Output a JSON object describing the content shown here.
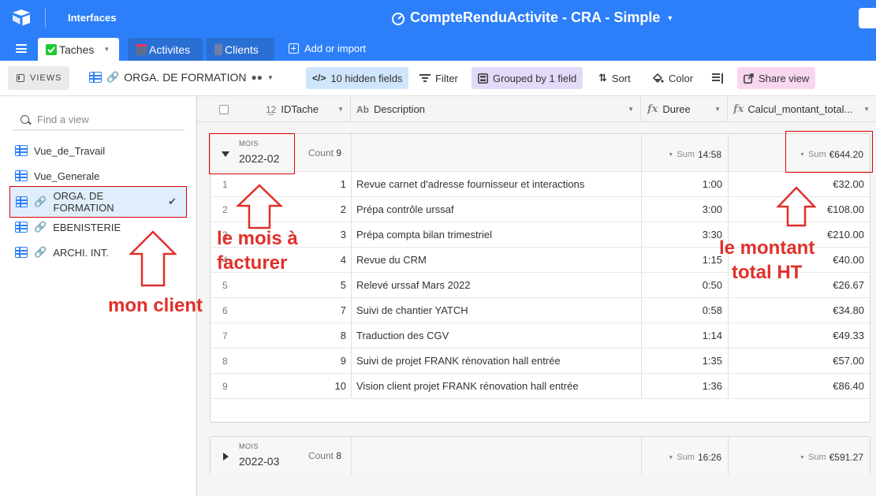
{
  "topbar": {
    "interfaces": "Interfaces",
    "base_title": "CompteRenduActivite - CRA - Simple",
    "accent": "#2d7ff9"
  },
  "tabs": [
    {
      "label": "Taches",
      "icon": "check-square-icon",
      "color": "#20c933"
    },
    {
      "label": "Activites",
      "icon": "table-icon",
      "color": "#f82b60"
    },
    {
      "label": "Clients",
      "icon": "people-icon",
      "color": "#8b46ff"
    }
  ],
  "add_import": "Add or import",
  "toolbar": {
    "views": "VIEWS",
    "view_name": "ORGA. DE FORMATION",
    "hidden_fields": "10 hidden fields",
    "filter": "Filter",
    "grouped": "Grouped by 1 field",
    "sort": "Sort",
    "color": "Color",
    "share": "Share view"
  },
  "sidebar": {
    "find_placeholder": "Find a view",
    "items": [
      {
        "label": "Vue_de_Travail"
      },
      {
        "label": "Vue_Generale"
      },
      {
        "label": "ORGA. DE FORMATION"
      },
      {
        "label": "EBENISTERIE"
      },
      {
        "label": "ARCHI. INT."
      }
    ]
  },
  "columns": {
    "id": "IDTache",
    "desc": "Description",
    "dur": "Duree",
    "amt": "Calcul_montant_total..."
  },
  "groups": [
    {
      "label": "MOIS",
      "value": "2022-02",
      "count_label": "Count",
      "count": "9",
      "sum_label": "Sum",
      "sum_duree": "14:58",
      "sum_montant": "€644.20",
      "rows": [
        {
          "n": "1",
          "id": "1",
          "desc": "Revue carnet d'adresse fournisseur et interactions",
          "dur": "1:00",
          "amt": "€32.00"
        },
        {
          "n": "2",
          "id": "2",
          "desc": "Prépa contrôle urssaf",
          "dur": "3:00",
          "amt": "€108.00"
        },
        {
          "n": "3",
          "id": "3",
          "desc": "Prépa compta bilan trimestriel",
          "dur": "3:30",
          "amt": "€210.00"
        },
        {
          "n": "4",
          "id": "4",
          "desc": "Revue du CRM",
          "dur": "1:15",
          "amt": "€40.00"
        },
        {
          "n": "5",
          "id": "5",
          "desc": "Relevé urssaf Mars 2022",
          "dur": "0:50",
          "amt": "€26.67"
        },
        {
          "n": "6",
          "id": "7",
          "desc": "Suivi de chantier YATCH",
          "dur": "0:58",
          "amt": "€34.80"
        },
        {
          "n": "7",
          "id": "8",
          "desc": "Traduction des CGV",
          "dur": "1:14",
          "amt": "€49.33"
        },
        {
          "n": "8",
          "id": "9",
          "desc": "Suivi de projet FRANK rénovation hall entrée",
          "dur": "1:35",
          "amt": "€57.00"
        },
        {
          "n": "9",
          "id": "10",
          "desc": "Vision client projet FRANK rénovation hall entrée",
          "dur": "1:36",
          "amt": "€86.40"
        }
      ]
    },
    {
      "label": "MOIS",
      "value": "2022-03",
      "count_label": "Count",
      "count": "8",
      "sum_label": "Sum",
      "sum_duree": "16:26",
      "sum_montant": "€591.27"
    }
  ],
  "annotations": {
    "mois_line1": "le mois à",
    "mois_line2": "facturer",
    "client": "mon client",
    "montant_line1": "le montant",
    "montant_line2": "total HT",
    "color": "#e0302a"
  }
}
